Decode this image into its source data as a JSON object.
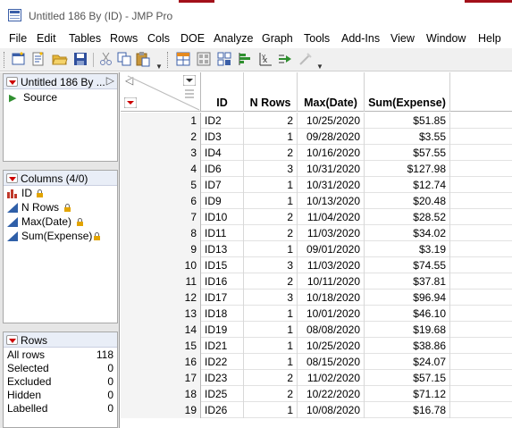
{
  "window": {
    "title": "Untitled 186 By (ID) - JMP Pro"
  },
  "menu": [
    "File",
    "Edit",
    "Tables",
    "Rows",
    "Cols",
    "DOE",
    "Analyze",
    "Graph",
    "Tools",
    "Add-Ins",
    "View",
    "Window",
    "Help"
  ],
  "toolbar": {
    "icons": [
      "new-data-table-icon",
      "new-script-icon",
      "open-icon",
      "save-icon",
      "cut-icon",
      "copy-icon",
      "paste-icon",
      "data-table-icon",
      "dashboard-icon",
      "graph-builder-icon",
      "distribution-icon",
      "fit-y-by-x-icon",
      "fit-model-icon",
      "disabled-tool-icon"
    ]
  },
  "table_panel": {
    "title": "Untitled 186 By ...",
    "source_label": "Source"
  },
  "columns_panel": {
    "title": "Columns (4/0)",
    "columns": [
      "ID",
      "N Rows",
      "Max(Date)",
      "Sum(Expense)"
    ]
  },
  "rows_panel": {
    "title": "Rows",
    "stats": [
      {
        "label": "All rows",
        "value": "118"
      },
      {
        "label": "Selected",
        "value": "0"
      },
      {
        "label": "Excluded",
        "value": "0"
      },
      {
        "label": "Hidden",
        "value": "0"
      },
      {
        "label": "Labelled",
        "value": "0"
      }
    ]
  },
  "grid": {
    "headers": [
      "ID",
      "N Rows",
      "Max(Date)",
      "Sum(Expense)"
    ],
    "rows": [
      [
        "1",
        "ID2",
        "2",
        "10/25/2020",
        "$51.85"
      ],
      [
        "2",
        "ID3",
        "1",
        "09/28/2020",
        "$3.55"
      ],
      [
        "3",
        "ID4",
        "2",
        "10/16/2020",
        "$57.55"
      ],
      [
        "4",
        "ID6",
        "3",
        "10/31/2020",
        "$127.98"
      ],
      [
        "5",
        "ID7",
        "1",
        "10/31/2020",
        "$12.74"
      ],
      [
        "6",
        "ID9",
        "1",
        "10/13/2020",
        "$20.48"
      ],
      [
        "7",
        "ID10",
        "2",
        "11/04/2020",
        "$28.52"
      ],
      [
        "8",
        "ID11",
        "2",
        "11/03/2020",
        "$34.02"
      ],
      [
        "9",
        "ID13",
        "1",
        "09/01/2020",
        "$3.19"
      ],
      [
        "10",
        "ID15",
        "3",
        "11/03/2020",
        "$74.55"
      ],
      [
        "11",
        "ID16",
        "2",
        "10/11/2020",
        "$37.81"
      ],
      [
        "12",
        "ID17",
        "3",
        "10/18/2020",
        "$96.94"
      ],
      [
        "13",
        "ID18",
        "1",
        "10/01/2020",
        "$46.10"
      ],
      [
        "14",
        "ID19",
        "1",
        "08/08/2020",
        "$19.68"
      ],
      [
        "15",
        "ID21",
        "1",
        "10/25/2020",
        "$38.86"
      ],
      [
        "16",
        "ID22",
        "1",
        "08/15/2020",
        "$24.07"
      ],
      [
        "17",
        "ID23",
        "2",
        "11/02/2020",
        "$57.15"
      ],
      [
        "18",
        "ID25",
        "2",
        "10/22/2020",
        "$71.12"
      ],
      [
        "19",
        "ID26",
        "1",
        "10/08/2020",
        "$16.78"
      ]
    ]
  },
  "colors": {
    "accent_red": "#cc0000",
    "brand_dark_red": "#a3101a",
    "header_blue": "#e9eef7"
  }
}
